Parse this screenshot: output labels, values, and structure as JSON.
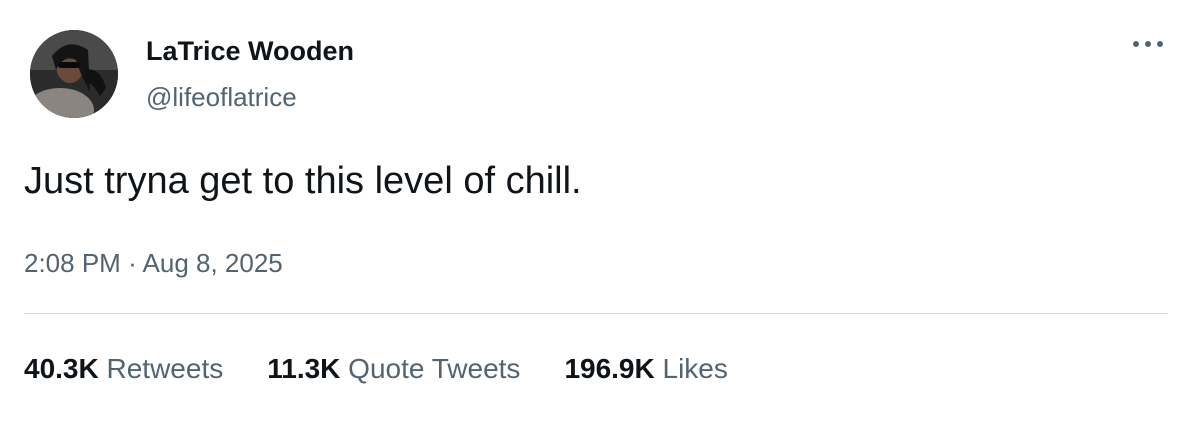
{
  "author": {
    "display_name": "LaTrice Wooden",
    "handle": "@lifeoflatrice"
  },
  "tweet": {
    "text": "Just tryna get to this level of chill.",
    "time": "2:08 PM",
    "separator": "·",
    "date": "Aug 8, 2025"
  },
  "stats": [
    {
      "count": "40.3K",
      "label": "Retweets"
    },
    {
      "count": "11.3K",
      "label": "Quote Tweets"
    },
    {
      "count": "196.9K",
      "label": "Likes"
    }
  ],
  "icons": {
    "more": "more-horizontal-icon"
  }
}
